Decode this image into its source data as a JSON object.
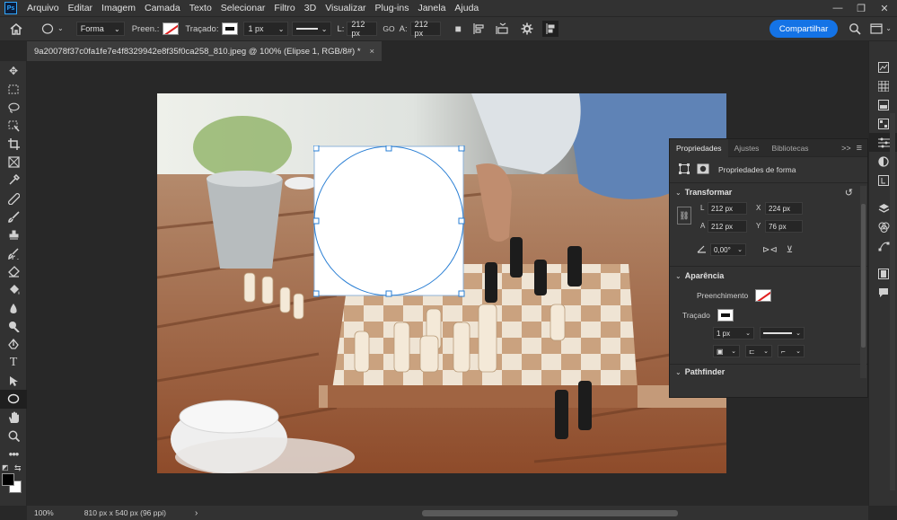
{
  "menubar": {
    "logo": "Ps",
    "items": [
      "Arquivo",
      "Editar",
      "Imagem",
      "Camada",
      "Texto",
      "Selecionar",
      "Filtro",
      "3D",
      "Visualizar",
      "Plug-ins",
      "Janela",
      "Ajuda"
    ],
    "minimize": "—",
    "maximize": "❐",
    "close": "✕"
  },
  "options": {
    "mode_value": "Forma",
    "fill_label": "Preen.:",
    "stroke_label": "Traçado:",
    "stroke_width": "1 px",
    "w_label": "L:",
    "w_value": "212 px",
    "link_label": "GO",
    "h_label": "A:",
    "h_value": "212 px",
    "share_label": "Compartilhar"
  },
  "document": {
    "tab_title": "9a20078f37c0fa1fe7e4f8329942e8f35f0ca258_810.jpeg @ 100% (Elipse 1, RGB/8#) *",
    "tab_close": "×"
  },
  "status": {
    "zoom": "100%",
    "doc_info": "810 px x 540 px (96 ppi)",
    "arrow": "›"
  },
  "properties": {
    "tabs": [
      "Propriedades",
      "Ajustes",
      "Bibliotecas"
    ],
    "collapse": ">>",
    "menu": "≡",
    "kind": "Propriedades de forma",
    "transform_title": "Transformar",
    "w_label": "L",
    "w_value": "212 px",
    "x_label": "X",
    "x_value": "224 px",
    "h_label": "A",
    "h_value": "212 px",
    "y_label": "Y",
    "y_value": "76 px",
    "angle_value": "0,00°",
    "appearance_title": "Aparência",
    "fill_label": "Preenchimento",
    "stroke_label": "Traçado",
    "stroke_width": "1 px",
    "pathfinder_title": "Pathfinder"
  },
  "colors": {
    "accent": "#1473e6",
    "selection": "#2a7fd4"
  }
}
